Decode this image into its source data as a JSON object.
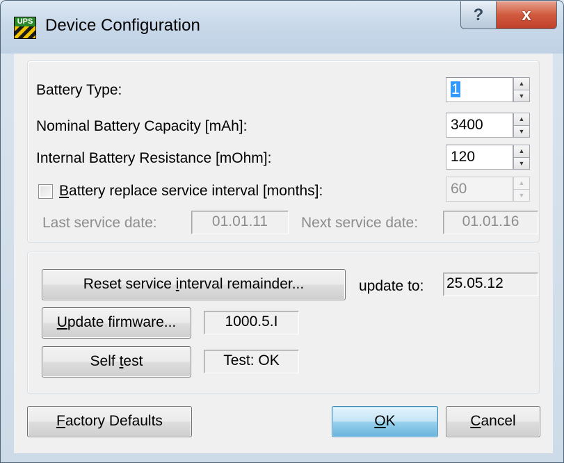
{
  "window": {
    "title": "Device Configuration",
    "icon": "ups-icon",
    "help_glyph": "?",
    "close_glyph": "x"
  },
  "config": {
    "battery_type": {
      "label": "Battery Type:",
      "value": "1"
    },
    "capacity": {
      "label": "Nominal Battery Capacity [mAh]:",
      "value": "3400"
    },
    "resistance": {
      "label": "Internal Battery Resistance [mOhm]:",
      "value": "120"
    },
    "service_interval": {
      "label_first": "B",
      "label_rest": "attery replace service interval [months]:",
      "value": "60",
      "checked": false
    },
    "last_service": {
      "label": "Last service date:",
      "value": "01.01.11"
    },
    "next_service": {
      "label": "Next service date:",
      "value": "01.01.16"
    }
  },
  "actions": {
    "reset": {
      "label_pre": "Reset service ",
      "label_u": "i",
      "label_post": "nterval remainder...",
      "update_to_label": "update to:",
      "update_to_value": "25.05.12"
    },
    "firmware": {
      "label_u": "U",
      "label_post": "pdate firmware...",
      "version": "1000.5.I"
    },
    "selftest": {
      "label_pre": "Self ",
      "label_u": "t",
      "label_post": "est",
      "result": "Test: OK"
    }
  },
  "footer": {
    "factory": {
      "label_u": "F",
      "label_post": "actory Defaults"
    },
    "ok": {
      "label_u": "O",
      "label_post": "K"
    },
    "cancel": {
      "label_u": "C",
      "label_post": "ancel"
    }
  },
  "spin_glyphs": {
    "up": "▲",
    "down": "▼"
  }
}
